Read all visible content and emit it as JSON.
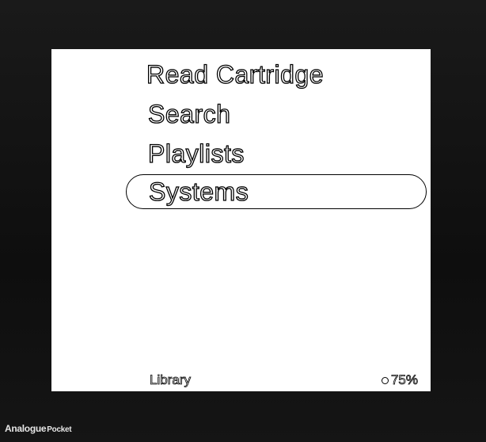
{
  "menu": {
    "items": [
      {
        "label": "Read Cartridge"
      },
      {
        "label": "Search"
      },
      {
        "label": "Playlists"
      },
      {
        "label": "Systems",
        "selected": true
      }
    ]
  },
  "status": {
    "section": "Library",
    "battery": "75%",
    "battery_level_percent": 75
  },
  "device": {
    "brand_name": "Analogue",
    "model_name": "Pocket"
  },
  "colors": {
    "bezel": "#111111",
    "screen": "#ffffff",
    "text_outline": "#000000"
  }
}
